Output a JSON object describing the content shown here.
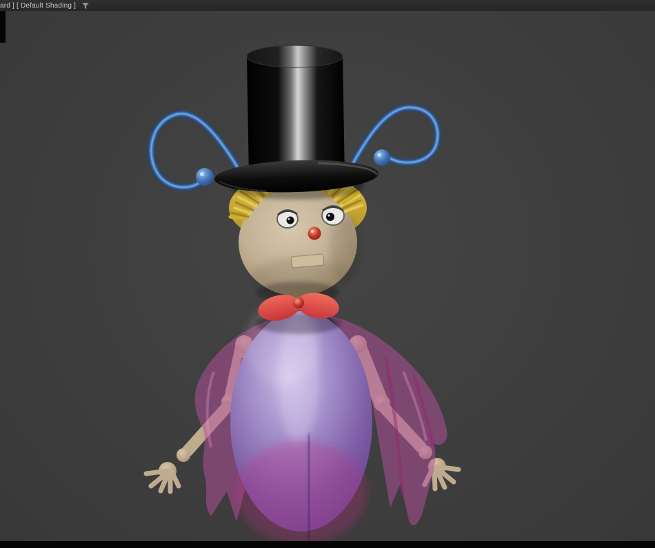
{
  "viewport": {
    "label": "ard ]  [ Default Shading ]",
    "filter_icon": "funnel"
  },
  "colors": {
    "background": "#3e3e3e",
    "header_bg": "#282828",
    "header_text": "#c9c9c9",
    "edge_strip": "#050505",
    "hat": "#0a0a0a",
    "hat_sheen": "#d6d6d6",
    "antenna_blue": "#3f6fae",
    "antenna_sphere_blue": "#4878b8",
    "hair_gold": "#cfae30",
    "hair_light": "#e3cb52",
    "hair_dark": "#a8851e",
    "skin": "#c2b094",
    "limb": "#bfab8e",
    "skin_shadow": "#a5947a",
    "eye_white": "#e9e9e6",
    "pupil": "#101010",
    "nose_red": "#c03a2a",
    "mouth_tan": "#cdbd9d",
    "collar_red": "#d8434a",
    "body_purple": "#7e5ea6",
    "body_highlight": "#cabce4",
    "cape_pink": "#b5509e"
  },
  "scene": {
    "description": "3D cartoon puppet character in viewport: black top hat, blue wire antennae with spheres, blonde spiky hair, round beige head, red nose, red collar, purple egg body, translucent pink cape, jointed beige arms and hands",
    "objects": [
      "top-hat",
      "antenna-left",
      "antenna-right",
      "hair",
      "head",
      "eye-left",
      "eye-right",
      "nose",
      "mouth",
      "collar",
      "cape",
      "body",
      "arm-left",
      "arm-right",
      "hand-left",
      "hand-right"
    ]
  }
}
